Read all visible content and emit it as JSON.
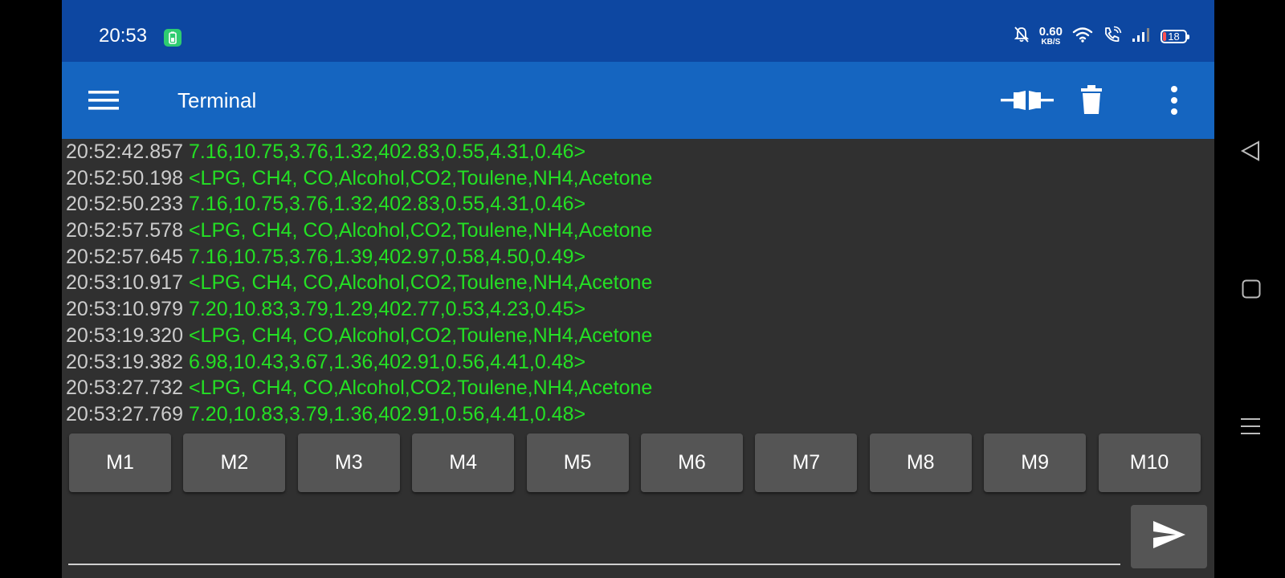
{
  "status_bar": {
    "time": "20:53",
    "net_speed_value": "0.60",
    "net_speed_unit": "KB/S",
    "battery_level": "18",
    "icons": [
      "battery-saver-icon",
      "mute-bell-icon",
      "wifi-icon",
      "wifi-call-icon",
      "signal-icon",
      "battery-icon"
    ]
  },
  "app_bar": {
    "title": "Terminal",
    "icons": [
      "menu-icon",
      "connect-plug-icon",
      "trash-icon",
      "more-vert-icon"
    ]
  },
  "terminal_log": [
    {
      "time": "20:52:42.857",
      "text": "7.16,10.75,3.76,1.32,402.83,0.55,4.31,0.46>"
    },
    {
      "time": "20:52:50.198",
      "text": "<LPG, CH4, CO,Alcohol,CO2,Toulene,NH4,Acetone"
    },
    {
      "time": "20:52:50.233",
      "text": "7.16,10.75,3.76,1.32,402.83,0.55,4.31,0.46>"
    },
    {
      "time": "20:52:57.578",
      "text": "<LPG, CH4, CO,Alcohol,CO2,Toulene,NH4,Acetone"
    },
    {
      "time": "20:52:57.645",
      "text": "7.16,10.75,3.76,1.39,402.97,0.58,4.50,0.49>"
    },
    {
      "time": "20:53:10.917",
      "text": "<LPG, CH4, CO,Alcohol,CO2,Toulene,NH4,Acetone"
    },
    {
      "time": "20:53:10.979",
      "text": "7.20,10.83,3.79,1.29,402.77,0.53,4.23,0.45>"
    },
    {
      "time": "20:53:19.320",
      "text": "<LPG, CH4, CO,Alcohol,CO2,Toulene,NH4,Acetone"
    },
    {
      "time": "20:53:19.382",
      "text": "6.98,10.43,3.67,1.36,402.91,0.56,4.41,0.48>"
    },
    {
      "time": "20:53:27.732",
      "text": "<LPG, CH4, CO,Alcohol,CO2,Toulene,NH4,Acetone"
    },
    {
      "time": "20:53:27.769",
      "text": "7.20,10.83,3.79,1.36,402.91,0.56,4.41,0.48>"
    }
  ],
  "macro_buttons": [
    "M1",
    "M2",
    "M3",
    "M4",
    "M5",
    "M6",
    "M7",
    "M8",
    "M9",
    "M10"
  ],
  "input": {
    "value": "",
    "placeholder": ""
  },
  "send_button": {
    "icon": "send-icon"
  },
  "nav_bar": {
    "icons": [
      "back-icon",
      "home-icon",
      "recents-icon"
    ]
  },
  "colors": {
    "status_bar_bg": "#0d47a1",
    "app_bar_bg": "#1565c0",
    "terminal_bg": "#303030",
    "timestamp_text": "#cccccc",
    "received_text": "#24e024",
    "button_bg": "#555555",
    "battery_badge": "#2ecc71"
  }
}
